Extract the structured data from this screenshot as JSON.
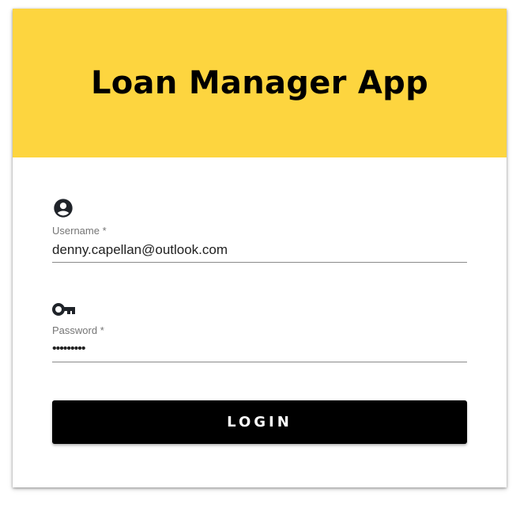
{
  "app": {
    "title": "Loan Manager App"
  },
  "form": {
    "username": {
      "icon": "account-circle-icon",
      "label": "Username *",
      "value": "denny.capellan@outlook.com"
    },
    "password": {
      "icon": "key-icon",
      "label": "Password *",
      "value": "•••••••••"
    },
    "login_label": "LOGIN"
  },
  "colors": {
    "header_bg": "#FDD53F",
    "button_bg": "#000000",
    "button_text": "#FFFFFF"
  }
}
